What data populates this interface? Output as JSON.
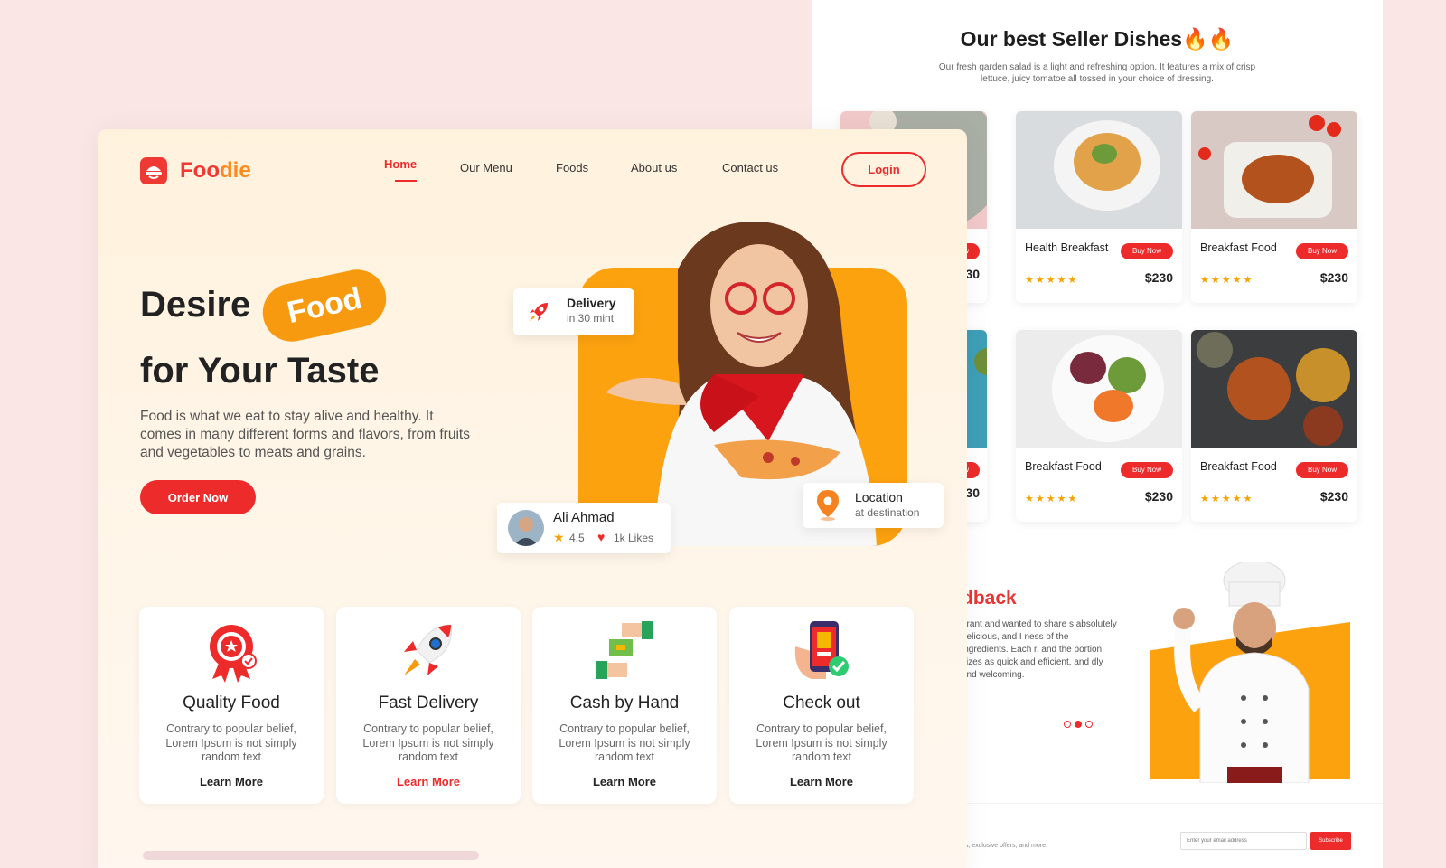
{
  "best_sellers": {
    "title": "Our best Seller Dishes🔥🔥",
    "subtitle": "Our fresh garden salad is a light and refreshing option. It features a mix of crisp lettuce, juicy tomatoe all tossed in your choice of dressing.",
    "dishes": [
      {
        "name": "",
        "button": "Now",
        "stars": "★★★★★",
        "price": "$230"
      },
      {
        "name": "Health Breakfast",
        "button": "Buy Now",
        "stars": "★★★★★",
        "price": "$230"
      },
      {
        "name": "Breakfast Food",
        "button": "Buy Now",
        "stars": "★★★★★",
        "price": "$230"
      },
      {
        "name": "",
        "button": "Now",
        "stars": "★★★★★",
        "price": "$230"
      },
      {
        "name": "Breakfast Food",
        "button": "Buy Now",
        "stars": "★★★★★",
        "price": "$230"
      },
      {
        "name": "Breakfast Food",
        "button": "Buy Now",
        "stars": "★★★★★",
        "price": "$230"
      }
    ]
  },
  "feedback": {
    "heading": "dback",
    "text": "urant and wanted to share s absolutely delicious, and I ness of the ingredients. Each r, and the portion sizes as quick and efficient, and dly and welcoming."
  },
  "newsletter": {
    "text": "s, exclusive offers, and more.",
    "placeholder": "Enter your email address",
    "button": "Subscribe"
  },
  "brand": {
    "logo_part1": "Foo",
    "logo_part2": "die",
    "primary": "#ee2b2b",
    "accent": "#fda20f"
  },
  "nav": {
    "items": [
      "Home",
      "Our Menu",
      "Foods",
      "About us",
      "Contact us"
    ],
    "login": "Login"
  },
  "hero": {
    "line1": "Desire",
    "pill": "Food",
    "line2": "for Your Taste",
    "paragraph": "Food is what we eat to stay alive and healthy. It comes in many different forms and flavors, from fruits and vegetables to meats and grains.",
    "cta": "Order Now"
  },
  "cards": {
    "delivery": {
      "title": "Delivery",
      "sub": "in 30 mint"
    },
    "profile": {
      "name": "Ali Ahmad",
      "rating": "4.5",
      "likes": "1k Likes"
    },
    "location": {
      "title": "Location",
      "sub": "at destination"
    }
  },
  "features": [
    {
      "title": "Quality Food",
      "text": "Contrary to popular belief, Lorem Ipsum is not simply random text",
      "link": "Learn More"
    },
    {
      "title": "Fast Delivery",
      "text": "Contrary to popular belief, Lorem Ipsum is not simply random text",
      "link": "Learn More"
    },
    {
      "title": "Cash by Hand",
      "text": "Contrary to popular belief, Lorem Ipsum is not simply random text",
      "link": "Learn More"
    },
    {
      "title": "Check out",
      "text": "Contrary to popular belief, Lorem Ipsum is not simply random text",
      "link": "Learn More"
    }
  ]
}
